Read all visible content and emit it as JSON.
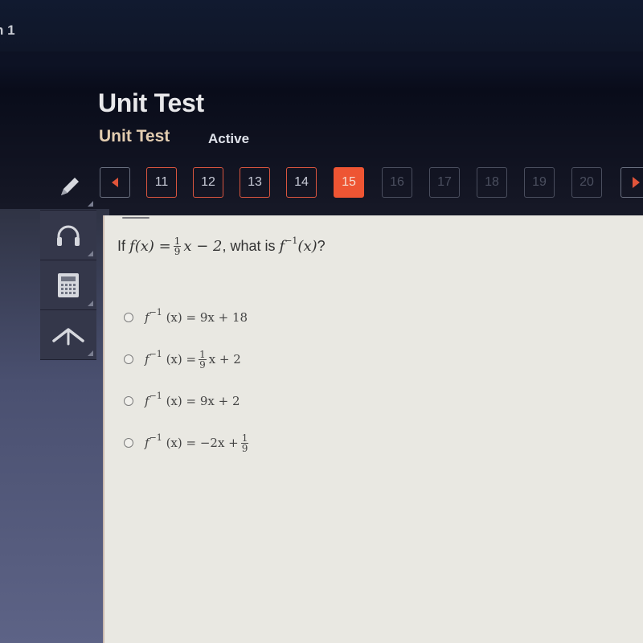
{
  "topbar": {
    "title_fragment": "n 1"
  },
  "header": {
    "title": "Unit Test",
    "subtitle": "Unit Test",
    "status": "Active"
  },
  "pager": {
    "prev_icon": "triangle-left-icon",
    "next_icon": "triangle-right-icon",
    "pages": [
      {
        "label": "11",
        "state": "visited"
      },
      {
        "label": "12",
        "state": "visited"
      },
      {
        "label": "13",
        "state": "visited"
      },
      {
        "label": "14",
        "state": "visited"
      },
      {
        "label": "15",
        "state": "current"
      },
      {
        "label": "16",
        "state": "disabled"
      },
      {
        "label": "17",
        "state": "disabled"
      },
      {
        "label": "18",
        "state": "disabled"
      },
      {
        "label": "19",
        "state": "disabled"
      },
      {
        "label": "20",
        "state": "disabled"
      }
    ]
  },
  "tools": [
    {
      "name": "pencil-icon"
    },
    {
      "name": "headphones-icon"
    },
    {
      "name": "calculator-icon"
    },
    {
      "name": "arrow-up-icon"
    }
  ],
  "question": {
    "prefix": "If",
    "fx": "f(x) =",
    "frac_num": "1",
    "frac_den": "9",
    "rest": "x − 2",
    "middle": ", what is",
    "finv": "f",
    "finv_sup": "−1",
    "finv_arg": "(x)",
    "suffix": "?"
  },
  "options": [
    {
      "lhs": "f",
      "sup": "−1",
      "arg": "(x) = ",
      "pre": "9x + 18",
      "frac_num": "",
      "frac_den": "",
      "post": ""
    },
    {
      "lhs": "f",
      "sup": "−1",
      "arg": "(x) = ",
      "pre": "",
      "frac_num": "1",
      "frac_den": "9",
      "post": "x + 2"
    },
    {
      "lhs": "f",
      "sup": "−1",
      "arg": "(x) = ",
      "pre": "9x + 2",
      "frac_num": "",
      "frac_den": "",
      "post": ""
    },
    {
      "lhs": "f",
      "sup": "−1",
      "arg": "(x) = ",
      "pre": "−2x +",
      "frac_num": "1",
      "frac_den": "9",
      "post": ""
    }
  ],
  "colors": {
    "accent": "#ee5533",
    "content_bg": "#e9e8e2",
    "header_bg": "#0f1628"
  }
}
